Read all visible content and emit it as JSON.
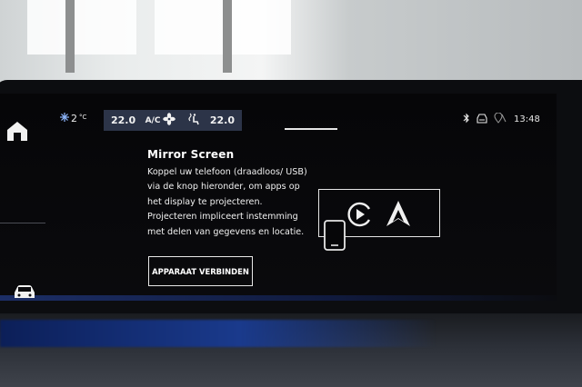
{
  "status_bar": {
    "outside_temp": "2",
    "outside_temp_unit": "°C",
    "climate": {
      "left_temp": "22.0",
      "ac_label": "A/C",
      "right_temp": "22.0"
    },
    "time": "13:48",
    "icons": [
      "snowflake-icon",
      "fan-icon",
      "seat-heat-icon",
      "bluetooth-icon",
      "car-connect-icon",
      "location-off-icon"
    ]
  },
  "sidebar": {
    "icons": [
      "home-icon",
      "car-icon"
    ]
  },
  "mirror_screen": {
    "title": "Mirror Screen",
    "description": "Koppel uw telefoon (draadloos/ USB) via de knop hieronder, om apps op het display te projecteren. Projecteren impliceert instemming met delen van gegevens en locatie.",
    "connect_button_label": "APPARAAT VERBINDEN",
    "illustration_icons": [
      "phone-icon",
      "carplay-icon",
      "android-auto-icon"
    ]
  },
  "colors": {
    "screen_bg": "#060608",
    "climate_bg": "#2c3448",
    "text": "#f0f0f0",
    "ambient_blue": "#1a3a8c"
  }
}
